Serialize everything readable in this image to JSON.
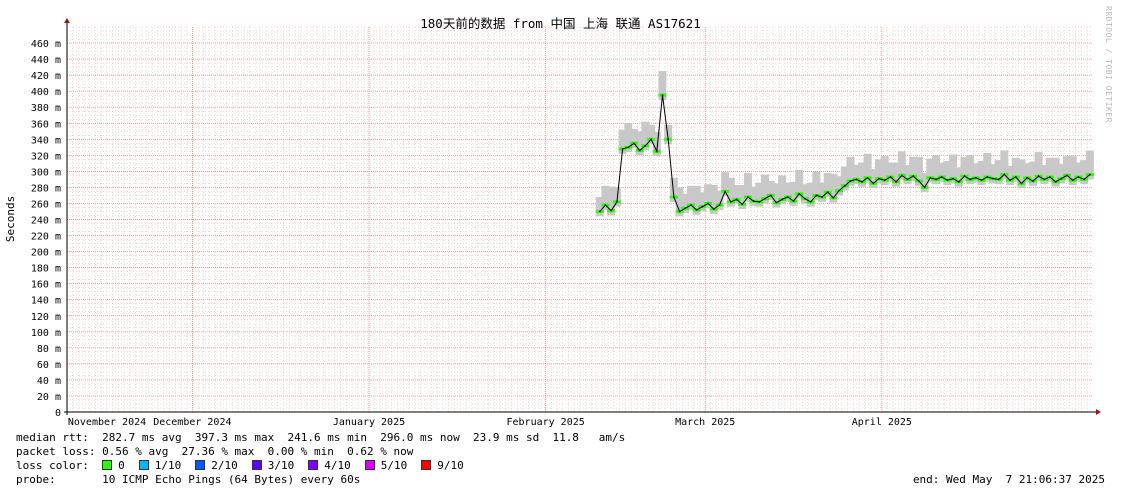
{
  "colors": {
    "median_line": "#000000",
    "smoke": "#c8c8c8",
    "grid_minor": "#f0b0b0",
    "grid_major": "#e08080",
    "axis": "#000000",
    "arrow": "#a01010"
  },
  "legend": {
    "median_label": "median rtt:",
    "median_values": "282.7 ms avg  397.3 ms max  241.6 ms min  296.0 ms now  23.9 ms sd  11.8   am/s",
    "loss_label": "packet loss:",
    "loss_values": "0.56 % avg  27.36 % max  0.00 % min  0.62 % now",
    "color_label": "loss color:",
    "loss_colors": [
      {
        "label": "0",
        "color": "#26ff00"
      },
      {
        "label": "1/10",
        "color": "#00b8ff"
      },
      {
        "label": "2/10",
        "color": "#0059ff"
      },
      {
        "label": "3/10",
        "color": "#5e00ff"
      },
      {
        "label": "4/10",
        "color": "#7e00ff"
      },
      {
        "label": "5/10",
        "color": "#dd00ff"
      },
      {
        "label": "9/10",
        "color": "#ff0000"
      }
    ],
    "probe_label": "probe:",
    "probe_value": "10 ICMP Echo Pings (64 Bytes) every 60s",
    "end_text": "end: Wed May  7 21:06:37 2025"
  },
  "watermark": "RRDTOOL / TOBI OETIKER",
  "chart_data": {
    "type": "line",
    "title": "180天前的数据 from 中国 上海 联通 AS17621",
    "ylabel": "Seconds",
    "xlabel": "",
    "ylim": [
      0,
      480
    ],
    "yticks": [
      0,
      20,
      40,
      60,
      80,
      100,
      120,
      140,
      160,
      180,
      200,
      220,
      240,
      260,
      280,
      300,
      320,
      340,
      360,
      380,
      400,
      420,
      440,
      460
    ],
    "ytick_labels": [
      "0",
      "20 m",
      "40 m",
      "60 m",
      "80 m",
      "100 m",
      "120 m",
      "140 m",
      "160 m",
      "180 m",
      "200 m",
      "220 m",
      "240 m",
      "260 m",
      "280 m",
      "300 m",
      "320 m",
      "340 m",
      "360 m",
      "380 m",
      "400 m",
      "420 m",
      "440 m",
      "460 m"
    ],
    "xlim": [
      "2024-11-09",
      "2025-05-07"
    ],
    "xticks": [
      {
        "date": "2024-11-01",
        "label": "November 2024"
      },
      {
        "date": "2024-12-01",
        "label": "December 2024"
      },
      {
        "date": "2025-01-01",
        "label": "January 2025"
      },
      {
        "date": "2025-02-01",
        "label": "February 2025"
      },
      {
        "date": "2025-03-01",
        "label": "March 2025"
      },
      {
        "date": "2025-04-01",
        "label": "April 2025"
      }
    ],
    "grid": true,
    "series": [
      {
        "values_unit": "ms",
        "points": [
          [
            "2025-02-10",
            250
          ],
          [
            "2025-02-11",
            258
          ],
          [
            "2025-02-12",
            251
          ],
          [
            "2025-02-13",
            262
          ],
          [
            "2025-02-14",
            328
          ],
          [
            "2025-02-15",
            330
          ],
          [
            "2025-02-16",
            335
          ],
          [
            "2025-02-17",
            326
          ],
          [
            "2025-02-18",
            332
          ],
          [
            "2025-02-19",
            340
          ],
          [
            "2025-02-20",
            325
          ],
          [
            "2025-02-21",
            395
          ],
          [
            "2025-02-22",
            340
          ],
          [
            "2025-02-23",
            268
          ],
          [
            "2025-02-24",
            250
          ],
          [
            "2025-02-25",
            254
          ],
          [
            "2025-02-26",
            258
          ],
          [
            "2025-02-27",
            252
          ],
          [
            "2025-02-28",
            256
          ],
          [
            "2025-03-01",
            260
          ],
          [
            "2025-03-02",
            253
          ],
          [
            "2025-03-03",
            258
          ],
          [
            "2025-03-04",
            275
          ],
          [
            "2025-03-05",
            262
          ],
          [
            "2025-03-06",
            265
          ],
          [
            "2025-03-07",
            259
          ],
          [
            "2025-03-08",
            268
          ],
          [
            "2025-03-09",
            263
          ],
          [
            "2025-03-10",
            262
          ],
          [
            "2025-03-11",
            266
          ],
          [
            "2025-03-12",
            270
          ],
          [
            "2025-03-13",
            261
          ],
          [
            "2025-03-14",
            265
          ],
          [
            "2025-03-15",
            268
          ],
          [
            "2025-03-16",
            263
          ],
          [
            "2025-03-17",
            272
          ],
          [
            "2025-03-18",
            266
          ],
          [
            "2025-03-19",
            262
          ],
          [
            "2025-03-20",
            270
          ],
          [
            "2025-03-21",
            268
          ],
          [
            "2025-03-22",
            274
          ],
          [
            "2025-03-23",
            267
          ],
          [
            "2025-03-24",
            276
          ],
          [
            "2025-03-25",
            282
          ],
          [
            "2025-03-26",
            288
          ],
          [
            "2025-03-27",
            290
          ],
          [
            "2025-03-28",
            287
          ],
          [
            "2025-03-29",
            292
          ],
          [
            "2025-03-30",
            285
          ],
          [
            "2025-03-31",
            291
          ],
          [
            "2025-04-01",
            289
          ],
          [
            "2025-04-02",
            293
          ],
          [
            "2025-04-03",
            287
          ],
          [
            "2025-04-04",
            295
          ],
          [
            "2025-04-05",
            290
          ],
          [
            "2025-04-06",
            294
          ],
          [
            "2025-04-07",
            288
          ],
          [
            "2025-04-08",
            280
          ],
          [
            "2025-04-09",
            292
          ],
          [
            "2025-04-10",
            290
          ],
          [
            "2025-04-11",
            293
          ],
          [
            "2025-04-12",
            289
          ],
          [
            "2025-04-13",
            291
          ],
          [
            "2025-04-14",
            287
          ],
          [
            "2025-04-15",
            294
          ],
          [
            "2025-04-16",
            290
          ],
          [
            "2025-04-17",
            292
          ],
          [
            "2025-04-18",
            289
          ],
          [
            "2025-04-19",
            293
          ],
          [
            "2025-04-20",
            291
          ],
          [
            "2025-04-21",
            290
          ],
          [
            "2025-04-22",
            296
          ],
          [
            "2025-04-23",
            289
          ],
          [
            "2025-04-24",
            293
          ],
          [
            "2025-04-25",
            285
          ],
          [
            "2025-04-26",
            292
          ],
          [
            "2025-04-27",
            288
          ],
          [
            "2025-04-28",
            294
          ],
          [
            "2025-04-29",
            290
          ],
          [
            "2025-04-30",
            293
          ],
          [
            "2025-05-01",
            287
          ],
          [
            "2025-05-02",
            291
          ],
          [
            "2025-05-03",
            295
          ],
          [
            "2025-05-04",
            289
          ],
          [
            "2025-05-05",
            293
          ],
          [
            "2025-05-06",
            290
          ],
          [
            "2025-05-07",
            296
          ]
        ]
      }
    ]
  }
}
